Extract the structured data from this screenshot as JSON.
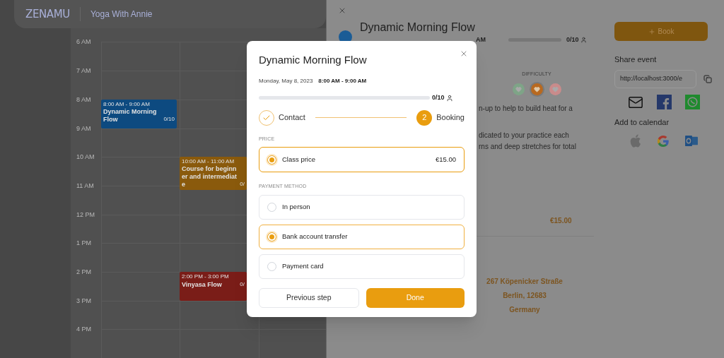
{
  "app_header": {
    "logo": "ZENAMU",
    "studio": "Yoga With Annie"
  },
  "calendar": {
    "hours": [
      "6 AM",
      "7 AM",
      "8 AM",
      "9 AM",
      "10 AM",
      "11 AM",
      "12 PM",
      "1 PM",
      "2 PM",
      "3 PM",
      "4 PM"
    ],
    "events": [
      {
        "time": "8:00 AM - 9:00 AM",
        "title": "Dynamic Morning Flow",
        "count": "0/10",
        "color": "#0d4a80"
      },
      {
        "time": "10:00 AM - 11:00 AM",
        "title": "Course for beginner and intermediate",
        "count": "0/",
        "color": "#8a5a0c"
      },
      {
        "time": "2:00 PM - 3:00 PM",
        "title": "Vinyasa Flow",
        "count": "0/",
        "color": "#7a1d18"
      }
    ]
  },
  "detail_panel": {
    "title": "Dynamic Morning Flow",
    "time_fragment": "AM",
    "capacity": {
      "level": 0,
      "count": "0/10"
    },
    "difficulty": {
      "label": "DIFFICULTY",
      "levels": [
        {
          "selected": false,
          "color": "#7ea487"
        },
        {
          "selected": true,
          "color": "#b8691f"
        },
        {
          "selected": false,
          "color": "#c98b8b"
        }
      ]
    },
    "description_paragraphs": [
      [
        "n-up to help to build heat for a"
      ],
      [
        "dicated to your practice each",
        "rns and deep stretches for total"
      ]
    ],
    "price": "€15.00",
    "address_lines": [
      "267 Köpenicker Straße",
      "Berlin, 12683",
      "Germany"
    ],
    "book_button": "Book",
    "share_title": "Share event",
    "share_url": "http://localhost:3000/e",
    "calendar_title": "Add to calendar"
  },
  "booking_modal": {
    "title": "Dynamic Morning Flow",
    "date": "Monday, May 8, 2023",
    "time": "8:00 AM - 9:00 AM",
    "capacity": {
      "level": 0,
      "count": "0/10"
    },
    "steps": [
      {
        "label": "Contact",
        "completed": true
      },
      {
        "label": "Booking",
        "number": "2",
        "completed": false
      }
    ],
    "price_label": "PRICE",
    "price_options": [
      {
        "label": "Class price",
        "amount": "€15.00",
        "selected": true
      }
    ],
    "payment_label": "PAYMENT METHOD",
    "payment_options": [
      {
        "label": "In person",
        "selected": false
      },
      {
        "label": "Bank account transfer",
        "selected": true
      },
      {
        "label": "Payment card",
        "selected": false
      }
    ],
    "previous_button": "Previous step",
    "done_button": "Done"
  }
}
